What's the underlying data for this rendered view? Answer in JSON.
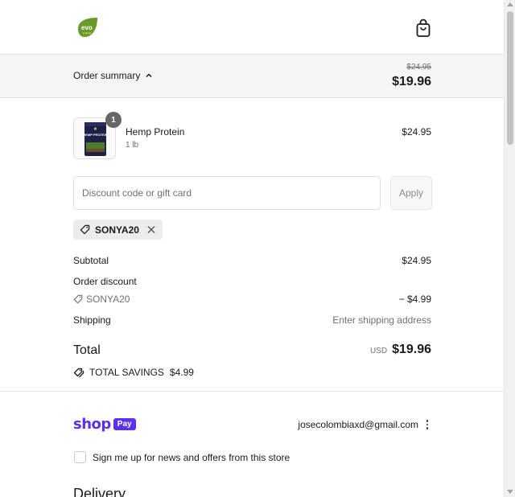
{
  "header": {
    "logo_text": "evo",
    "logo_subtext": "& hemp",
    "cart_icon": "shopping-bag-icon"
  },
  "summary": {
    "toggle_label": "Order summary",
    "toggle_icon": "chevron-up-icon",
    "original_total": "$24.95",
    "total": "$19.96"
  },
  "product": {
    "name": "Hemp Protein",
    "variant": "1 lb",
    "price": "$24.95",
    "quantity": "1",
    "image_label": "HEMP PROTEIN"
  },
  "discount": {
    "placeholder": "Discount code or gift card",
    "apply_label": "Apply",
    "applied_code": "SONYA20"
  },
  "totals": {
    "subtotal_label": "Subtotal",
    "subtotal_value": "$24.95",
    "order_discount_label": "Order discount",
    "discount_code": "SONYA20",
    "discount_value": "− $4.99",
    "shipping_label": "Shipping",
    "shipping_value": "Enter shipping address",
    "total_label": "Total",
    "currency": "USD",
    "total_value": "$19.96",
    "savings_label": "TOTAL SAVINGS",
    "savings_value": "$4.99"
  },
  "shop_pay": {
    "shop_word": "shop",
    "pay_word": "Pay",
    "email": "josecolombiaxd@gmail.com",
    "newsletter_label": "Sign me up for news and offers from this store"
  },
  "delivery_heading": "Delivery",
  "colors": {
    "brand_green": "#6a9a2a",
    "shop_purple": "#5a31f4",
    "summary_bg": "#f5f5f5"
  }
}
